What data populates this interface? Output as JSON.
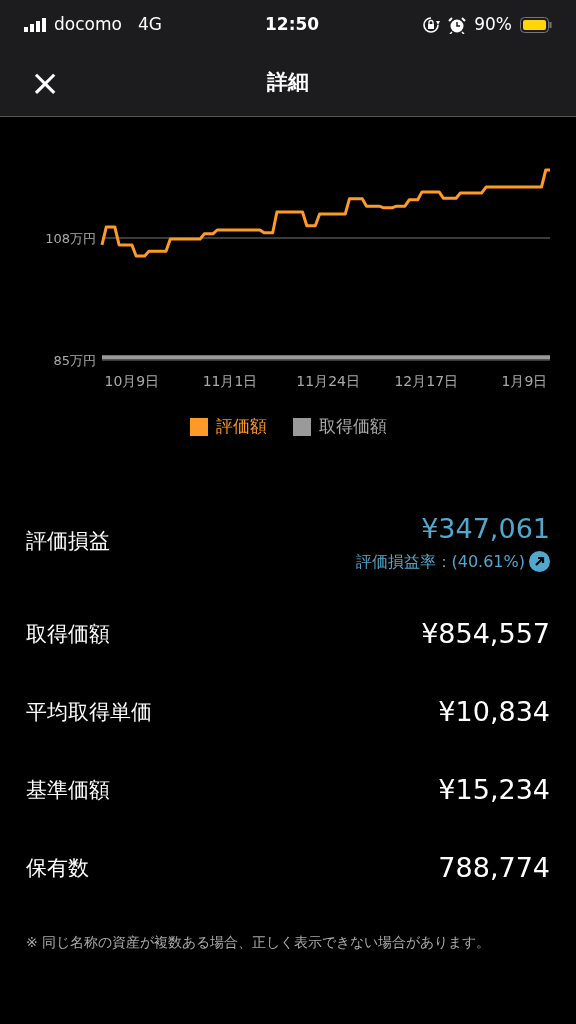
{
  "status_bar": {
    "carrier": "docomo",
    "network": "4G",
    "time": "12:50",
    "battery": "90%"
  },
  "header": {
    "close": "×",
    "title": "詳細"
  },
  "chart_data": {
    "type": "line",
    "ylim": [
      85,
      131
    ],
    "yticks": [
      {
        "value": 85,
        "label": "85万円"
      },
      {
        "value": 108,
        "label": "108万円"
      }
    ],
    "categories": [
      null,
      null,
      null,
      null,
      null,
      null,
      null,
      "10月9日",
      null,
      null,
      null,
      null,
      null,
      null,
      null,
      null,
      null,
      null,
      null,
      null,
      null,
      null,
      null,
      null,
      null,
      null,
      null,
      null,
      null,
      null,
      "11月1日",
      null,
      null,
      null,
      null,
      null,
      null,
      null,
      null,
      null,
      null,
      null,
      null,
      null,
      null,
      null,
      null,
      null,
      null,
      null,
      null,
      null,
      null,
      "11月24日",
      null,
      null,
      null,
      null,
      null,
      null,
      null,
      null,
      null,
      null,
      null,
      null,
      null,
      null,
      null,
      null,
      null,
      null,
      null,
      null,
      null,
      null,
      "12月17日",
      null,
      null,
      null,
      null,
      null,
      null,
      null,
      null,
      null,
      null,
      null,
      null,
      null,
      null,
      null,
      null,
      null,
      null,
      null,
      null,
      null,
      null,
      "1月9日",
      null,
      null,
      null,
      null,
      null,
      null
    ],
    "series": [
      {
        "name": "評価額",
        "color": "#ff9a26",
        "values": [
          106.7,
          110.1,
          110.1,
          110.1,
          106.7,
          106.7,
          106.7,
          106.7,
          104.6,
          104.6,
          104.6,
          105.5,
          105.5,
          105.5,
          105.5,
          105.5,
          107.8,
          107.8,
          107.8,
          107.8,
          107.8,
          107.8,
          107.8,
          107.8,
          108.8,
          108.8,
          108.8,
          109.5,
          109.5,
          109.5,
          109.5,
          109.5,
          109.5,
          109.5,
          109.5,
          109.5,
          109.5,
          109.5,
          109,
          109,
          109,
          112.9,
          112.9,
          112.9,
          112.9,
          112.9,
          112.9,
          112.9,
          110.3,
          110.3,
          110.3,
          112.5,
          112.5,
          112.5,
          112.5,
          112.5,
          112.5,
          112.5,
          115.4,
          115.4,
          115.4,
          115.4,
          114,
          114,
          114,
          114,
          113.7,
          113.7,
          113.7,
          114,
          114,
          114,
          115.2,
          115.2,
          115.2,
          116.7,
          116.7,
          116.7,
          116.7,
          116.7,
          115.5,
          115.5,
          115.5,
          115.5,
          116.5,
          116.5,
          116.5,
          116.5,
          116.5,
          116.5,
          117.6,
          117.6,
          117.6,
          117.6,
          117.6,
          117.6,
          117.6,
          117.6,
          117.6,
          117.6,
          117.6,
          117.6,
          117.6,
          117.6,
          120.8,
          120.8
        ]
      },
      {
        "name": "取得価額",
        "color": "#9a9a9a",
        "values": [
          85.5,
          85.5,
          85.5,
          85.5,
          85.5,
          85.5,
          85.5,
          85.5,
          85.5,
          85.5,
          85.5,
          85.5,
          85.5,
          85.5,
          85.5,
          85.5,
          85.5,
          85.5,
          85.5,
          85.5,
          85.5,
          85.5,
          85.5,
          85.5,
          85.5,
          85.5,
          85.5,
          85.5,
          85.5,
          85.5,
          85.5,
          85.5,
          85.5,
          85.5,
          85.5,
          85.5,
          85.5,
          85.5,
          85.5,
          85.5,
          85.5,
          85.5,
          85.5,
          85.5,
          85.5,
          85.5,
          85.5,
          85.5,
          85.5,
          85.5,
          85.5,
          85.5,
          85.5,
          85.5,
          85.5,
          85.5,
          85.5,
          85.5,
          85.5,
          85.5,
          85.5,
          85.5,
          85.5,
          85.5,
          85.5,
          85.5,
          85.5,
          85.5,
          85.5,
          85.5,
          85.5,
          85.5,
          85.5,
          85.5,
          85.5,
          85.5,
          85.5,
          85.5,
          85.5,
          85.5,
          85.5,
          85.5,
          85.5,
          85.5,
          85.5,
          85.5,
          85.5,
          85.5,
          85.5,
          85.5,
          85.5,
          85.5,
          85.5,
          85.5,
          85.5,
          85.5,
          85.5,
          85.5,
          85.5,
          85.5,
          85.5,
          85.5,
          85.5,
          85.5,
          85.5,
          85.5
        ]
      }
    ]
  },
  "rows": [
    {
      "kind": "profit",
      "label": "評価損益",
      "value": "¥347,061",
      "sub": "評価損益率：(40.61%)"
    },
    {
      "kind": "plain",
      "label": "取得価額",
      "value": "¥854,557"
    },
    {
      "kind": "plain",
      "label": "平均取得単価",
      "value": "¥10,834"
    },
    {
      "kind": "plain",
      "label": "基準価額",
      "value": "¥15,234"
    },
    {
      "kind": "plain",
      "label": "保有数",
      "value": "788,774"
    }
  ],
  "note": "※ 同じ名称の資産が複数ある場合、正しく表示できない場合があります。"
}
